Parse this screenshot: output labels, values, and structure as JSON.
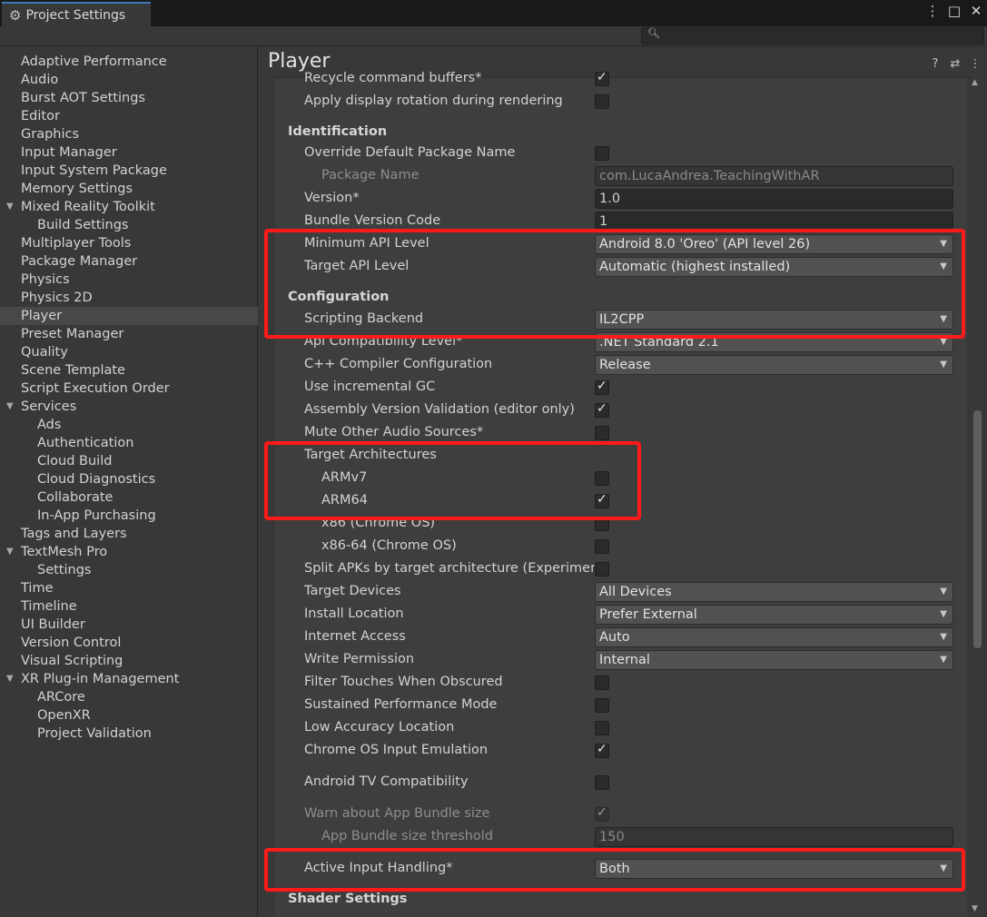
{
  "window": {
    "title": "Project Settings",
    "controls": {
      "menu": "⋮",
      "maximize": "□",
      "close": "✕"
    }
  },
  "search": {
    "placeholder": "",
    "icon": "search-icon"
  },
  "sidebar": {
    "items": [
      {
        "label": "Adaptive Performance"
      },
      {
        "label": "Audio"
      },
      {
        "label": "Burst AOT Settings"
      },
      {
        "label": "Editor"
      },
      {
        "label": "Graphics"
      },
      {
        "label": "Input Manager"
      },
      {
        "label": "Input System Package"
      },
      {
        "label": "Memory Settings"
      },
      {
        "label": "Mixed Reality Toolkit",
        "expanded": true
      },
      {
        "label": "Build Settings",
        "child": true
      },
      {
        "label": "Multiplayer Tools"
      },
      {
        "label": "Package Manager"
      },
      {
        "label": "Physics"
      },
      {
        "label": "Physics 2D"
      },
      {
        "label": "Player",
        "selected": true
      },
      {
        "label": "Preset Manager"
      },
      {
        "label": "Quality"
      },
      {
        "label": "Scene Template"
      },
      {
        "label": "Script Execution Order"
      },
      {
        "label": "Services",
        "expanded": true
      },
      {
        "label": "Ads",
        "child": true
      },
      {
        "label": "Authentication",
        "child": true
      },
      {
        "label": "Cloud Build",
        "child": true
      },
      {
        "label": "Cloud Diagnostics",
        "child": true
      },
      {
        "label": "Collaborate",
        "child": true
      },
      {
        "label": "In-App Purchasing",
        "child": true
      },
      {
        "label": "Tags and Layers"
      },
      {
        "label": "TextMesh Pro",
        "expanded": true
      },
      {
        "label": "Settings",
        "child": true
      },
      {
        "label": "Time"
      },
      {
        "label": "Timeline"
      },
      {
        "label": "UI Builder"
      },
      {
        "label": "Version Control"
      },
      {
        "label": "Visual Scripting"
      },
      {
        "label": "XR Plug-in Management",
        "expanded": true
      },
      {
        "label": "ARCore",
        "child": true
      },
      {
        "label": "OpenXR",
        "child": true
      },
      {
        "label": "Project Validation",
        "child": true
      }
    ]
  },
  "content": {
    "title": "Player",
    "header_icons": [
      "help-icon",
      "presets-icon",
      "more-icon"
    ],
    "rows": [
      {
        "type": "checkbox",
        "label": "Recycle command buffers*",
        "checked": true
      },
      {
        "type": "checkbox",
        "label": "Apply display rotation during rendering",
        "checked": false
      },
      {
        "type": "header",
        "label": "Identification"
      },
      {
        "type": "checkbox",
        "label": "Override Default Package Name",
        "checked": false
      },
      {
        "type": "field",
        "label": "Package Name",
        "value": "com.LucaAndrea.TeachingWithAR",
        "disabled": true,
        "indent": 2
      },
      {
        "type": "field",
        "label": "Version*",
        "value": "1.0"
      },
      {
        "type": "field",
        "label": "Bundle Version Code",
        "value": "1"
      },
      {
        "type": "dropdown",
        "label": "Minimum API Level",
        "value": "Android 8.0 'Oreo' (API level 26)"
      },
      {
        "type": "dropdown",
        "label": "Target API Level",
        "value": "Automatic (highest installed)"
      },
      {
        "type": "header",
        "label": "Configuration"
      },
      {
        "type": "dropdown",
        "label": "Scripting Backend",
        "value": "IL2CPP"
      },
      {
        "type": "dropdown",
        "label": "Api Compatibility Level*",
        "value": ".NET Standard 2.1"
      },
      {
        "type": "dropdown",
        "label": "C++ Compiler Configuration",
        "value": "Release"
      },
      {
        "type": "checkbox",
        "label": "Use incremental GC",
        "checked": true
      },
      {
        "type": "checkbox",
        "label": "Assembly Version Validation (editor only)",
        "checked": true
      },
      {
        "type": "checkbox",
        "label": "Mute Other Audio Sources*",
        "checked": false
      },
      {
        "type": "label",
        "label": "Target Architectures"
      },
      {
        "type": "checkbox",
        "label": "ARMv7",
        "checked": false,
        "indent": 2
      },
      {
        "type": "checkbox",
        "label": "ARM64",
        "checked": true,
        "indent": 2
      },
      {
        "type": "checkbox",
        "label": "x86 (Chrome OS)",
        "checked": false,
        "indent": 2
      },
      {
        "type": "checkbox",
        "label": "x86-64 (Chrome OS)",
        "checked": false,
        "indent": 2
      },
      {
        "type": "checkbox",
        "label": "Split APKs by target architecture (Experimen",
        "checked": false
      },
      {
        "type": "dropdown",
        "label": "Target Devices",
        "value": "All Devices"
      },
      {
        "type": "dropdown",
        "label": "Install Location",
        "value": "Prefer External"
      },
      {
        "type": "dropdown",
        "label": "Internet Access",
        "value": "Auto"
      },
      {
        "type": "dropdown",
        "label": "Write Permission",
        "value": "Internal"
      },
      {
        "type": "checkbox",
        "label": "Filter Touches When Obscured",
        "checked": false
      },
      {
        "type": "checkbox",
        "label": "Sustained Performance Mode",
        "checked": false
      },
      {
        "type": "checkbox",
        "label": "Low Accuracy Location",
        "checked": false
      },
      {
        "type": "checkbox",
        "label": "Chrome OS Input Emulation",
        "checked": true
      },
      {
        "type": "checkbox",
        "label": "Android TV Compatibility",
        "checked": false
      },
      {
        "type": "checkbox",
        "label": "Warn about App Bundle size",
        "checked": true,
        "disabled": true
      },
      {
        "type": "field",
        "label": "App Bundle size threshold",
        "value": "150",
        "disabled": true,
        "indent": 2
      },
      {
        "type": "dropdown",
        "label": "Active Input Handling*",
        "value": "Both"
      },
      {
        "type": "header",
        "label": "Shader Settings"
      }
    ]
  },
  "colors": {
    "highlight": "#ff1a1a",
    "accent": "#3a79bb",
    "background": "#383838"
  }
}
